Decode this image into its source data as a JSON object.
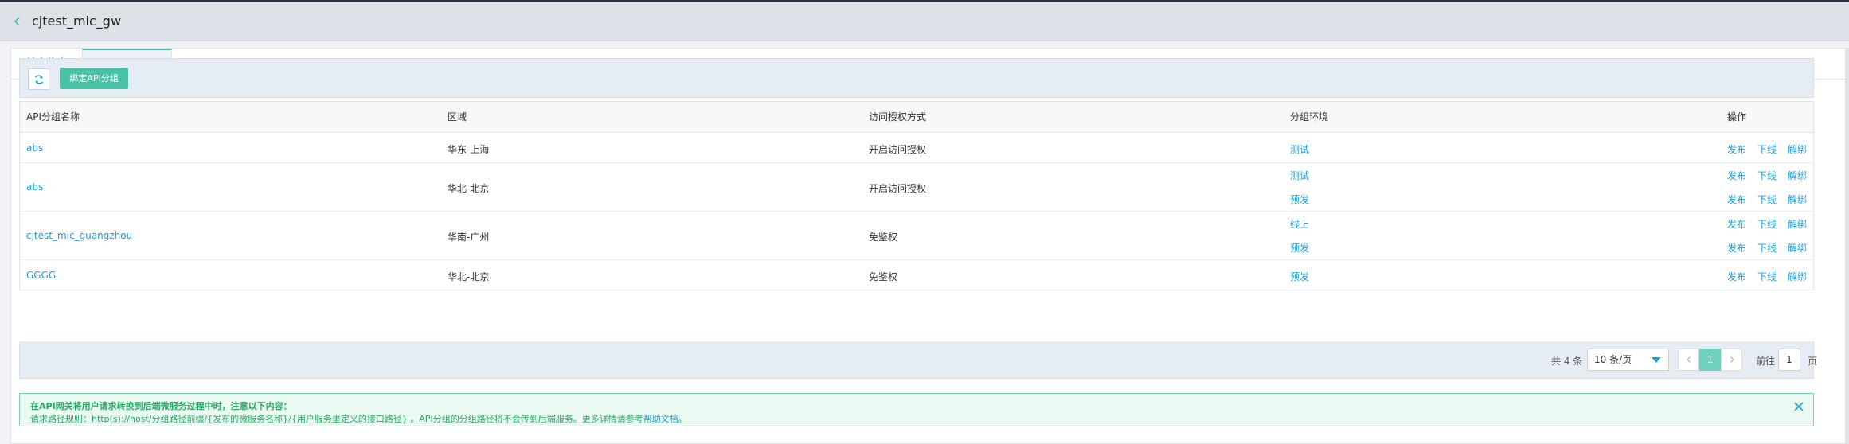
{
  "header": {
    "title": "cjtest_mic_gw"
  },
  "tabs": [
    {
      "label": "基本信息"
    },
    {
      "label": "API分组列表"
    }
  ],
  "toolbar": {
    "bind_label": "绑定API分组"
  },
  "table": {
    "columns": [
      "API分组名称",
      "区域",
      "访问授权方式",
      "分组环境",
      "操作"
    ],
    "rows": [
      {
        "name": "abs",
        "region": "华东-上海",
        "auth": "开启访问授权",
        "envs": [
          {
            "env": "测试",
            "ops": [
              "发布",
              "下线",
              "解绑"
            ]
          }
        ]
      },
      {
        "name": "abs",
        "region": "华北-北京",
        "auth": "开启访问授权",
        "envs": [
          {
            "env": "测试",
            "ops": [
              "发布",
              "下线",
              "解绑"
            ]
          },
          {
            "env": "预发",
            "ops": [
              "发布",
              "下线",
              "解绑"
            ]
          }
        ]
      },
      {
        "name": "cjtest_mic_guangzhou",
        "region": "华南-广州",
        "auth": "免鉴权",
        "envs": [
          {
            "env": "线上",
            "ops": [
              "发布",
              "下线",
              "解绑"
            ]
          },
          {
            "env": "预发",
            "ops": [
              "发布",
              "下线",
              "解绑"
            ]
          }
        ]
      },
      {
        "name": "GGGG",
        "region": "华北-北京",
        "auth": "免鉴权",
        "envs": [
          {
            "env": "预发",
            "ops": [
              "发布",
              "下线",
              "解绑"
            ]
          }
        ]
      }
    ]
  },
  "pagination": {
    "total_text": "共 4 条",
    "page_size": "10 条/页",
    "current_page": "1",
    "goto_label": "前往",
    "goto_value": "1",
    "page_unit": "页"
  },
  "notice": {
    "title": "在API网关将用户请求转换到后端微服务过程中时，注意以下内容：",
    "body": "请求路径规则：http(s)://host/分组路径前缀/{发布的微服务名称}/{用户服务里定义的接口路径} 。API分组的分组路径将不会传到后端服务。更多详情请参考",
    "help_link": "帮助文档",
    "end": "。"
  }
}
